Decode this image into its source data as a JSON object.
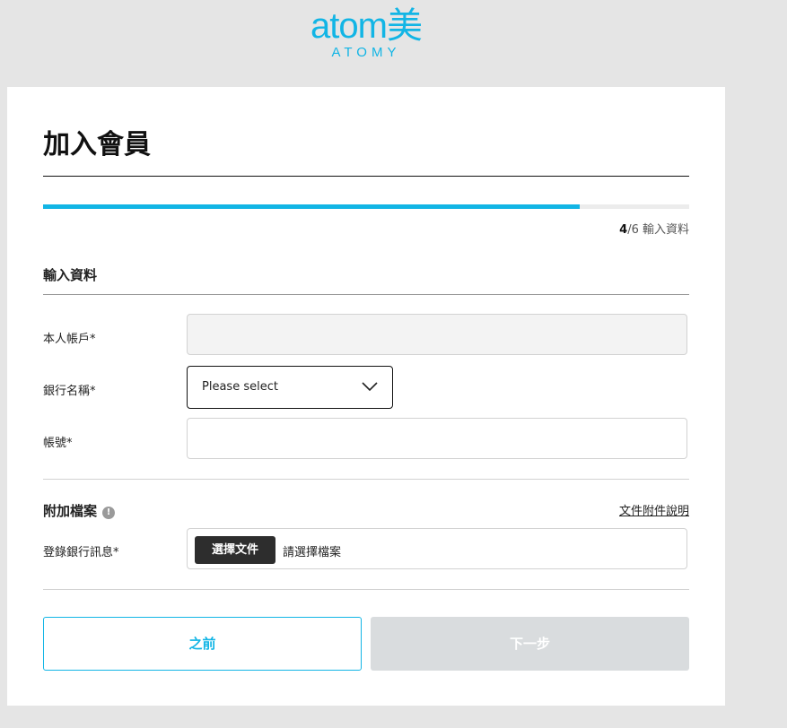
{
  "brand": {
    "logo_text": "atom美",
    "logo_sub": "ATOMY",
    "color": "#12b5e5"
  },
  "page": {
    "title": "加入會員"
  },
  "progress": {
    "fraction": 0.83,
    "current_step": "4",
    "total_steps": "/6",
    "step_name": "輸入資料"
  },
  "form": {
    "section_title": "輸入資料",
    "fields": {
      "account_holder": {
        "label": "本人帳戶*",
        "value": ""
      },
      "bank_name": {
        "label": "銀行名稱*",
        "selected": "Please select"
      },
      "account_number": {
        "label": "帳號*",
        "value": ""
      }
    }
  },
  "attachments": {
    "section_title": "附加檔案",
    "info_icon": "info-icon",
    "doc_link": "文件附件說明",
    "bank_info_label": "登錄銀行訊息*",
    "choose_button": "選擇文件",
    "placeholder": "請選擇檔案"
  },
  "actions": {
    "prev_label": "之前",
    "next_label": "下一步"
  }
}
